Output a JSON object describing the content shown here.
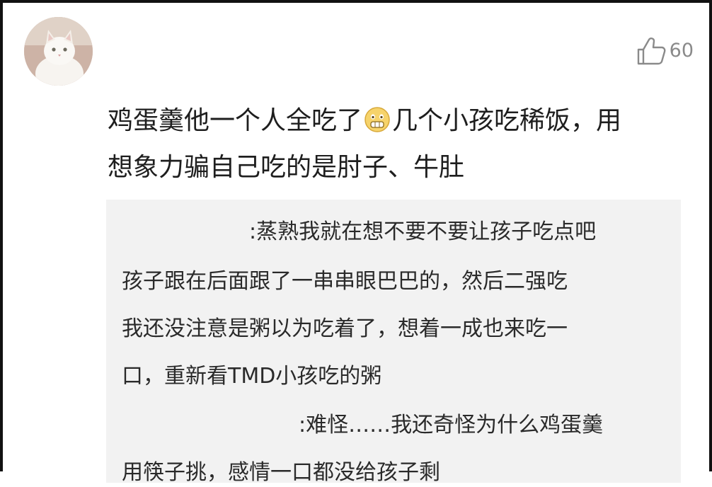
{
  "comment": {
    "avatar_icon": "white-cat-avatar",
    "like_icon": "thumbs-up-icon",
    "like_count": "60",
    "text_line1_part1": "鸡蛋羹他一个人全吃了",
    "emoji_icon": "grimace-emoji",
    "text_line1_part2": "几个小孩吃稀饭，用",
    "text_line2": "想象力骗自己吃的是肘子、牛肚"
  },
  "replies": {
    "lines": [
      ":蒸熟我就在想不要不要让孩子吃点吧",
      "孩子跟在后面跟了一串串眼巴巴的，然后二强吃",
      "我还没注意是粥以为吃着了，想着一成也来吃一",
      "口，重新看TMD小孩吃的粥",
      ":难怪……我还奇怪为什么鸡蛋羹",
      "用筷子挑，感情一口都没给孩子剩"
    ]
  }
}
